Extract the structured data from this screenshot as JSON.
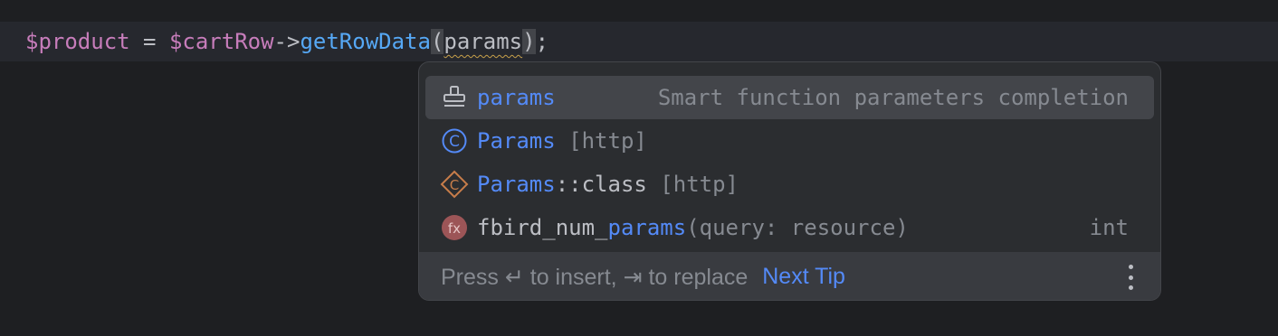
{
  "editor": {
    "code_line": {
      "var1": "$product",
      "assign": " = ",
      "var2": "$cartRow",
      "arrow": "->",
      "method": "getRowData",
      "open_paren": "(",
      "param": "params",
      "close_paren": ")",
      "semicolon": ";"
    }
  },
  "completion_popup": {
    "items": [
      {
        "icon": "stamp-icon",
        "name": "params",
        "description": "Smart function parameters completion",
        "selected": true
      },
      {
        "icon": "class-icon",
        "name": "Params",
        "suffix": " [http]"
      },
      {
        "icon": "class-constant-icon",
        "name_highlight": "Params",
        "name_rest": "::class",
        "suffix": " [http]"
      },
      {
        "icon": "function-icon",
        "name_plain": "fbird_num_",
        "name_highlight": "params",
        "signature": "(query: resource)",
        "return_type": "int"
      }
    ],
    "footer": {
      "hint": "Press ↵ to insert, ⇥ to replace",
      "next_tip_label": "Next Tip",
      "more_icon": "vertical-ellipsis-icon"
    }
  },
  "colors": {
    "background": "#1e1f22",
    "current_line": "#26282e",
    "popup_bg": "#2b2d30",
    "selected_row": "#43454a",
    "footer_bg": "#393b40",
    "highlight": "#548af7",
    "variable": "#c77dbb",
    "method": "#56a8f5",
    "dim_text": "#868a91"
  }
}
